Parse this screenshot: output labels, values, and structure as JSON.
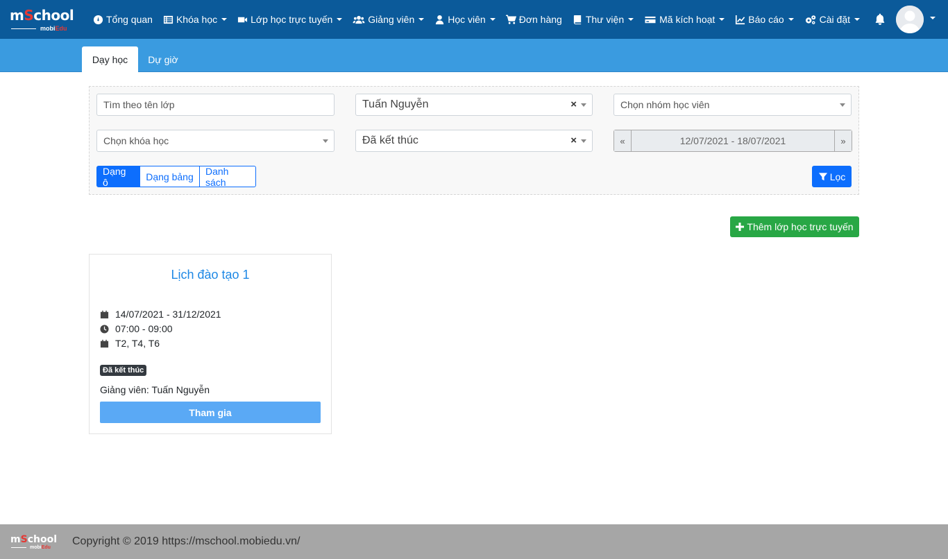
{
  "brand": {
    "name_pre": "m",
    "name_s": "S",
    "name_post": "chool",
    "sub_pre": "mobi",
    "sub_e": "Edu"
  },
  "nav": {
    "items": [
      {
        "label": "Tổng quan",
        "icon": "dashboard-icon",
        "dropdown": false
      },
      {
        "label": "Khóa học",
        "icon": "list-icon",
        "dropdown": true
      },
      {
        "label": "Lớp học trực tuyến",
        "icon": "video-icon",
        "dropdown": true
      },
      {
        "label": "Giảng viên",
        "icon": "users-icon",
        "dropdown": true
      },
      {
        "label": "Học viên",
        "icon": "user-icon",
        "dropdown": true
      },
      {
        "label": "Đơn hàng",
        "icon": "cart-icon",
        "dropdown": false
      },
      {
        "label": "Thư viện",
        "icon": "book-icon",
        "dropdown": true
      },
      {
        "label": "Mã kích hoạt",
        "icon": "credit-card-icon",
        "dropdown": true
      },
      {
        "label": "Báo cáo",
        "icon": "chart-icon",
        "dropdown": true
      },
      {
        "label": "Cài đặt",
        "icon": "gears-icon",
        "dropdown": true
      }
    ]
  },
  "tabs": {
    "teaching": "Dạy học",
    "observe": "Dự giờ"
  },
  "filters": {
    "class_name_placeholder": "Tìm theo tên lớp",
    "teacher_value": "Tuấn Nguyễn",
    "student_group_placeholder": "Chọn nhóm học viên",
    "course_placeholder": "Chọn khóa học",
    "status_value": "Đã kết thúc",
    "date_range": "12/07/2021 - 18/07/2021",
    "prev": "«",
    "next": "»",
    "clear": "×"
  },
  "view_modes": {
    "grid": "Dạng ô",
    "table": "Dạng bảng",
    "list": "Danh sách"
  },
  "actions": {
    "filter": "Lọc",
    "add_class": "Thêm lớp học trực tuyến"
  },
  "card": {
    "title": "Lịch đào tạo 1",
    "dates": "14/07/2021 - 31/12/2021",
    "time": "07:00 - 09:00",
    "days": "T2, T4, T6",
    "status": "Đã kết thúc",
    "teacher": "Giảng viên: Tuấn Nguyễn",
    "join": "Tham gia"
  },
  "footer": {
    "copyright": "Copyright © 2019 https://mschool.mobiedu.vn/"
  },
  "colors": {
    "navbar": "#0b5a9a",
    "subbar": "#3a9be0",
    "primary": "#0d6efd",
    "success": "#28a745",
    "join": "#5aa9f5"
  }
}
